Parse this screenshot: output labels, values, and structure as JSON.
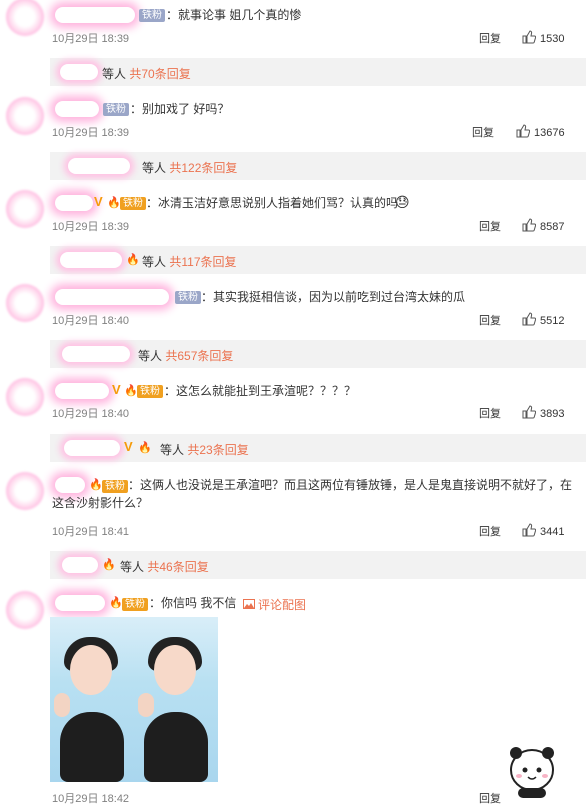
{
  "comments": [
    {
      "badge": "铁粉",
      "text": "：就事论事  姐几个真的惨",
      "time": "10月29日 18:39",
      "reply": "回复",
      "likes": "1530",
      "replies": {
        "who": "等人",
        "count": "共70条回复"
      }
    },
    {
      "badge": "铁粉",
      "text": "：别加戏了 好吗？",
      "time": "10月29日 18:39",
      "reply": "回复",
      "likes": "13676",
      "replies": {
        "who": "等人",
        "count": "共122条回复"
      }
    },
    {
      "badge": "铁粉",
      "text": "：冰清玉洁好意思说别人指着她们骂？认真的吗",
      "time": "10月29日 18:39",
      "reply": "回复",
      "likes": "8587",
      "replies": {
        "who": "等人",
        "count": "共117条回复"
      }
    },
    {
      "badge": "铁粉",
      "text": "：其实我挺相信谈，因为以前吃到过台湾太妹的瓜",
      "time": "10月29日 18:40",
      "reply": "回复",
      "likes": "5512",
      "replies": {
        "who": "等人",
        "count": "共657条回复"
      }
    },
    {
      "badge": "铁粉",
      "text": "：这怎么就能扯到王承渲呢？？？？",
      "time": "10月29日 18:40",
      "reply": "回复",
      "likes": "3893",
      "replies": {
        "who": "等人",
        "count": "共23条回复"
      }
    },
    {
      "badge": "铁粉",
      "text": "：这俩人也没说是王承渲吧？而且这两位有锤放锤，是人是鬼直接说明不就好了，在这含沙射影什么？",
      "time": "10月29日 18:41",
      "reply": "回复",
      "likes": "3441",
      "replies": {
        "who": "等人",
        "count": "共46条回复"
      }
    },
    {
      "badge": "铁粉",
      "text": "：你信吗 我不信",
      "pic_link": "评论配图",
      "time": "10月29日 18:42",
      "reply": "回复"
    }
  ],
  "icons": {
    "like": "thumbs-up-icon",
    "pic": "image-icon",
    "fan": "flame-icon",
    "verified": "v-icon"
  },
  "colors": {
    "count": "#eb7350",
    "link": "#eb7350",
    "badge_gray": "#9aa6c8",
    "badge_orange": "#f0a020"
  }
}
